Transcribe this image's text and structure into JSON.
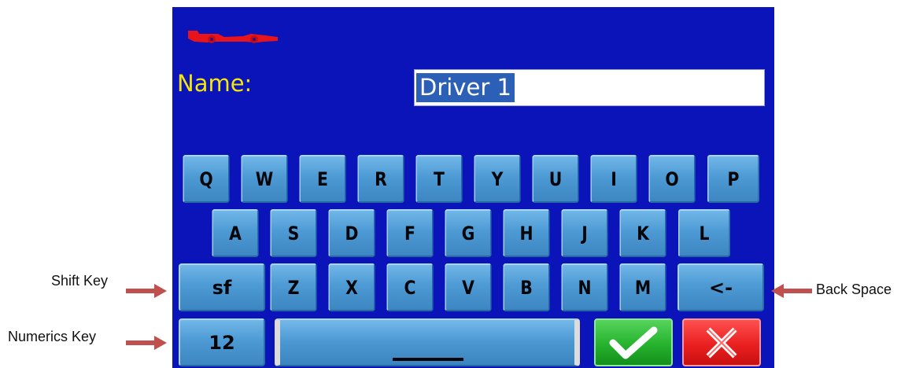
{
  "name_label": "Name:",
  "name_value": "Driver 1",
  "keyboard": {
    "row1": [
      "Q",
      "W",
      "E",
      "R",
      "T",
      "Y",
      "U",
      "I",
      "O",
      "P"
    ],
    "row2": [
      "A",
      "S",
      "D",
      "F",
      "G",
      "H",
      "J",
      "K",
      "L"
    ],
    "row3": [
      "sf",
      "Z",
      "X",
      "C",
      "V",
      "B",
      "N",
      "M",
      "<-"
    ],
    "numerics_label": "12"
  },
  "annotations": {
    "shift": "Shift Key",
    "numerics": "Numerics Key",
    "backspace": "Back Space"
  },
  "colors": {
    "background": "#0a14b8",
    "label": "#f4e60a",
    "confirm": "#26b22e",
    "cancel": "#ea2020",
    "arrow": "#c0504d"
  },
  "icons": {
    "logo": "race-car-icon",
    "confirm": "checkmark-icon",
    "cancel": "x-icon"
  }
}
